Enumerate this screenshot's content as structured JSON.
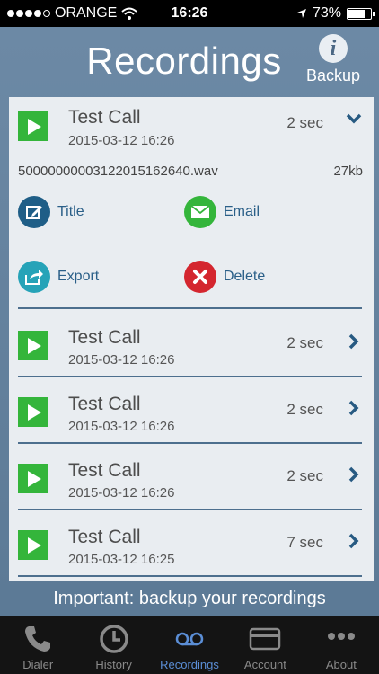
{
  "status_bar": {
    "carrier": "ORANGE",
    "time": "16:26",
    "battery_text": "73%",
    "battery_level": 0.73,
    "signal_bars_filled": 4,
    "signal_bars_total": 5
  },
  "header": {
    "title": "Recordings",
    "backup_label": "Backup",
    "info_icon": "i"
  },
  "expanded_item": {
    "title": "Test Call",
    "date": "2015-03-12 16:26",
    "duration": "2 sec",
    "file_name": "50000000003122015162640.wav",
    "file_size": "27kb",
    "actions": {
      "title_label": "Title",
      "email_label": "Email",
      "export_label": "Export",
      "delete_label": "Delete"
    }
  },
  "recordings": [
    {
      "title": "Test Call",
      "date": "2015-03-12 16:26",
      "duration": "2 sec"
    },
    {
      "title": "Test Call",
      "date": "2015-03-12 16:26",
      "duration": "2 sec"
    },
    {
      "title": "Test Call",
      "date": "2015-03-12 16:26",
      "duration": "2 sec"
    },
    {
      "title": "Test Call",
      "date": "2015-03-12 16:25",
      "duration": "7 sec"
    }
  ],
  "footer_note": "Important: backup your recordings",
  "tabs": [
    {
      "label": "Dialer",
      "icon": "phone-icon"
    },
    {
      "label": "History",
      "icon": "clock-icon"
    },
    {
      "label": "Recordings",
      "icon": "voicemail-icon"
    },
    {
      "label": "Account",
      "icon": "card-icon"
    },
    {
      "label": "About",
      "icon": "more-icon"
    }
  ],
  "colors": {
    "accent": "#5b8ed6",
    "play": "#34b53b",
    "title_action": "#1f5e87",
    "email_action": "#34b53b",
    "export_action": "#26a3b8",
    "delete_action": "#d4262f"
  }
}
